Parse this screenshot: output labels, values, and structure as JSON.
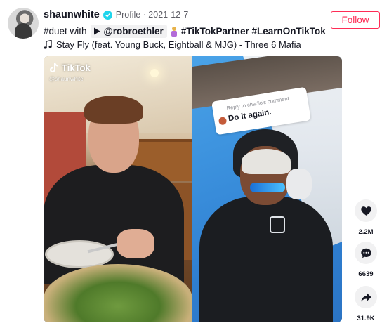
{
  "author": {
    "username": "shaunwhite",
    "subtitle": "Profile · 2021-12-7",
    "verified": true,
    "follow_label": "Follow"
  },
  "caption": {
    "prefix": "#duet with",
    "mention": "@robroethler",
    "tags": "#TikTokPartner #LearnOnTikTok"
  },
  "music": {
    "title": "Stay Fly (feat. Young Buck, Eightball & MJG) - Three 6 Mafia"
  },
  "video": {
    "watermark_brand": "TikTok",
    "watermark_handle": "@shaunwhite",
    "reply_label": "Reply to chadio's comment",
    "reply_text": "Do it again."
  },
  "actions": {
    "likes": "2.2M",
    "comments": "6639",
    "shares": "31.9K"
  },
  "colors": {
    "accent": "#fe2c55",
    "verified": "#20d5ec",
    "chip_bg": "#f1f1f2"
  },
  "icons": [
    "verified-badge-icon",
    "play-icon",
    "music-note-icon",
    "tiktok-logo-icon",
    "heart-icon",
    "comment-icon",
    "share-icon"
  ]
}
